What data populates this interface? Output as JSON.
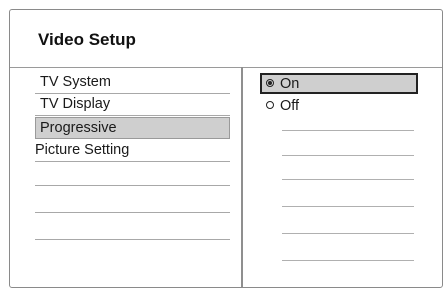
{
  "dialog": {
    "title": "Video Setup"
  },
  "menu": {
    "items": [
      {
        "label": "TV System",
        "selected": false
      },
      {
        "label": "TV Display",
        "selected": false
      },
      {
        "label": "Progressive",
        "selected": true
      },
      {
        "label": "Picture Setting",
        "selected": false
      }
    ],
    "empty_rows": 3
  },
  "options": {
    "items": [
      {
        "label": "On",
        "selected": true,
        "icon": "radio-checked-icon"
      },
      {
        "label": "Off",
        "selected": false,
        "icon": "radio-unchecked-icon"
      }
    ],
    "empty_rows": 6
  },
  "colors": {
    "highlight": "#cfcfcf",
    "border": "#8a8a8a",
    "text": "#1a1a1a"
  }
}
